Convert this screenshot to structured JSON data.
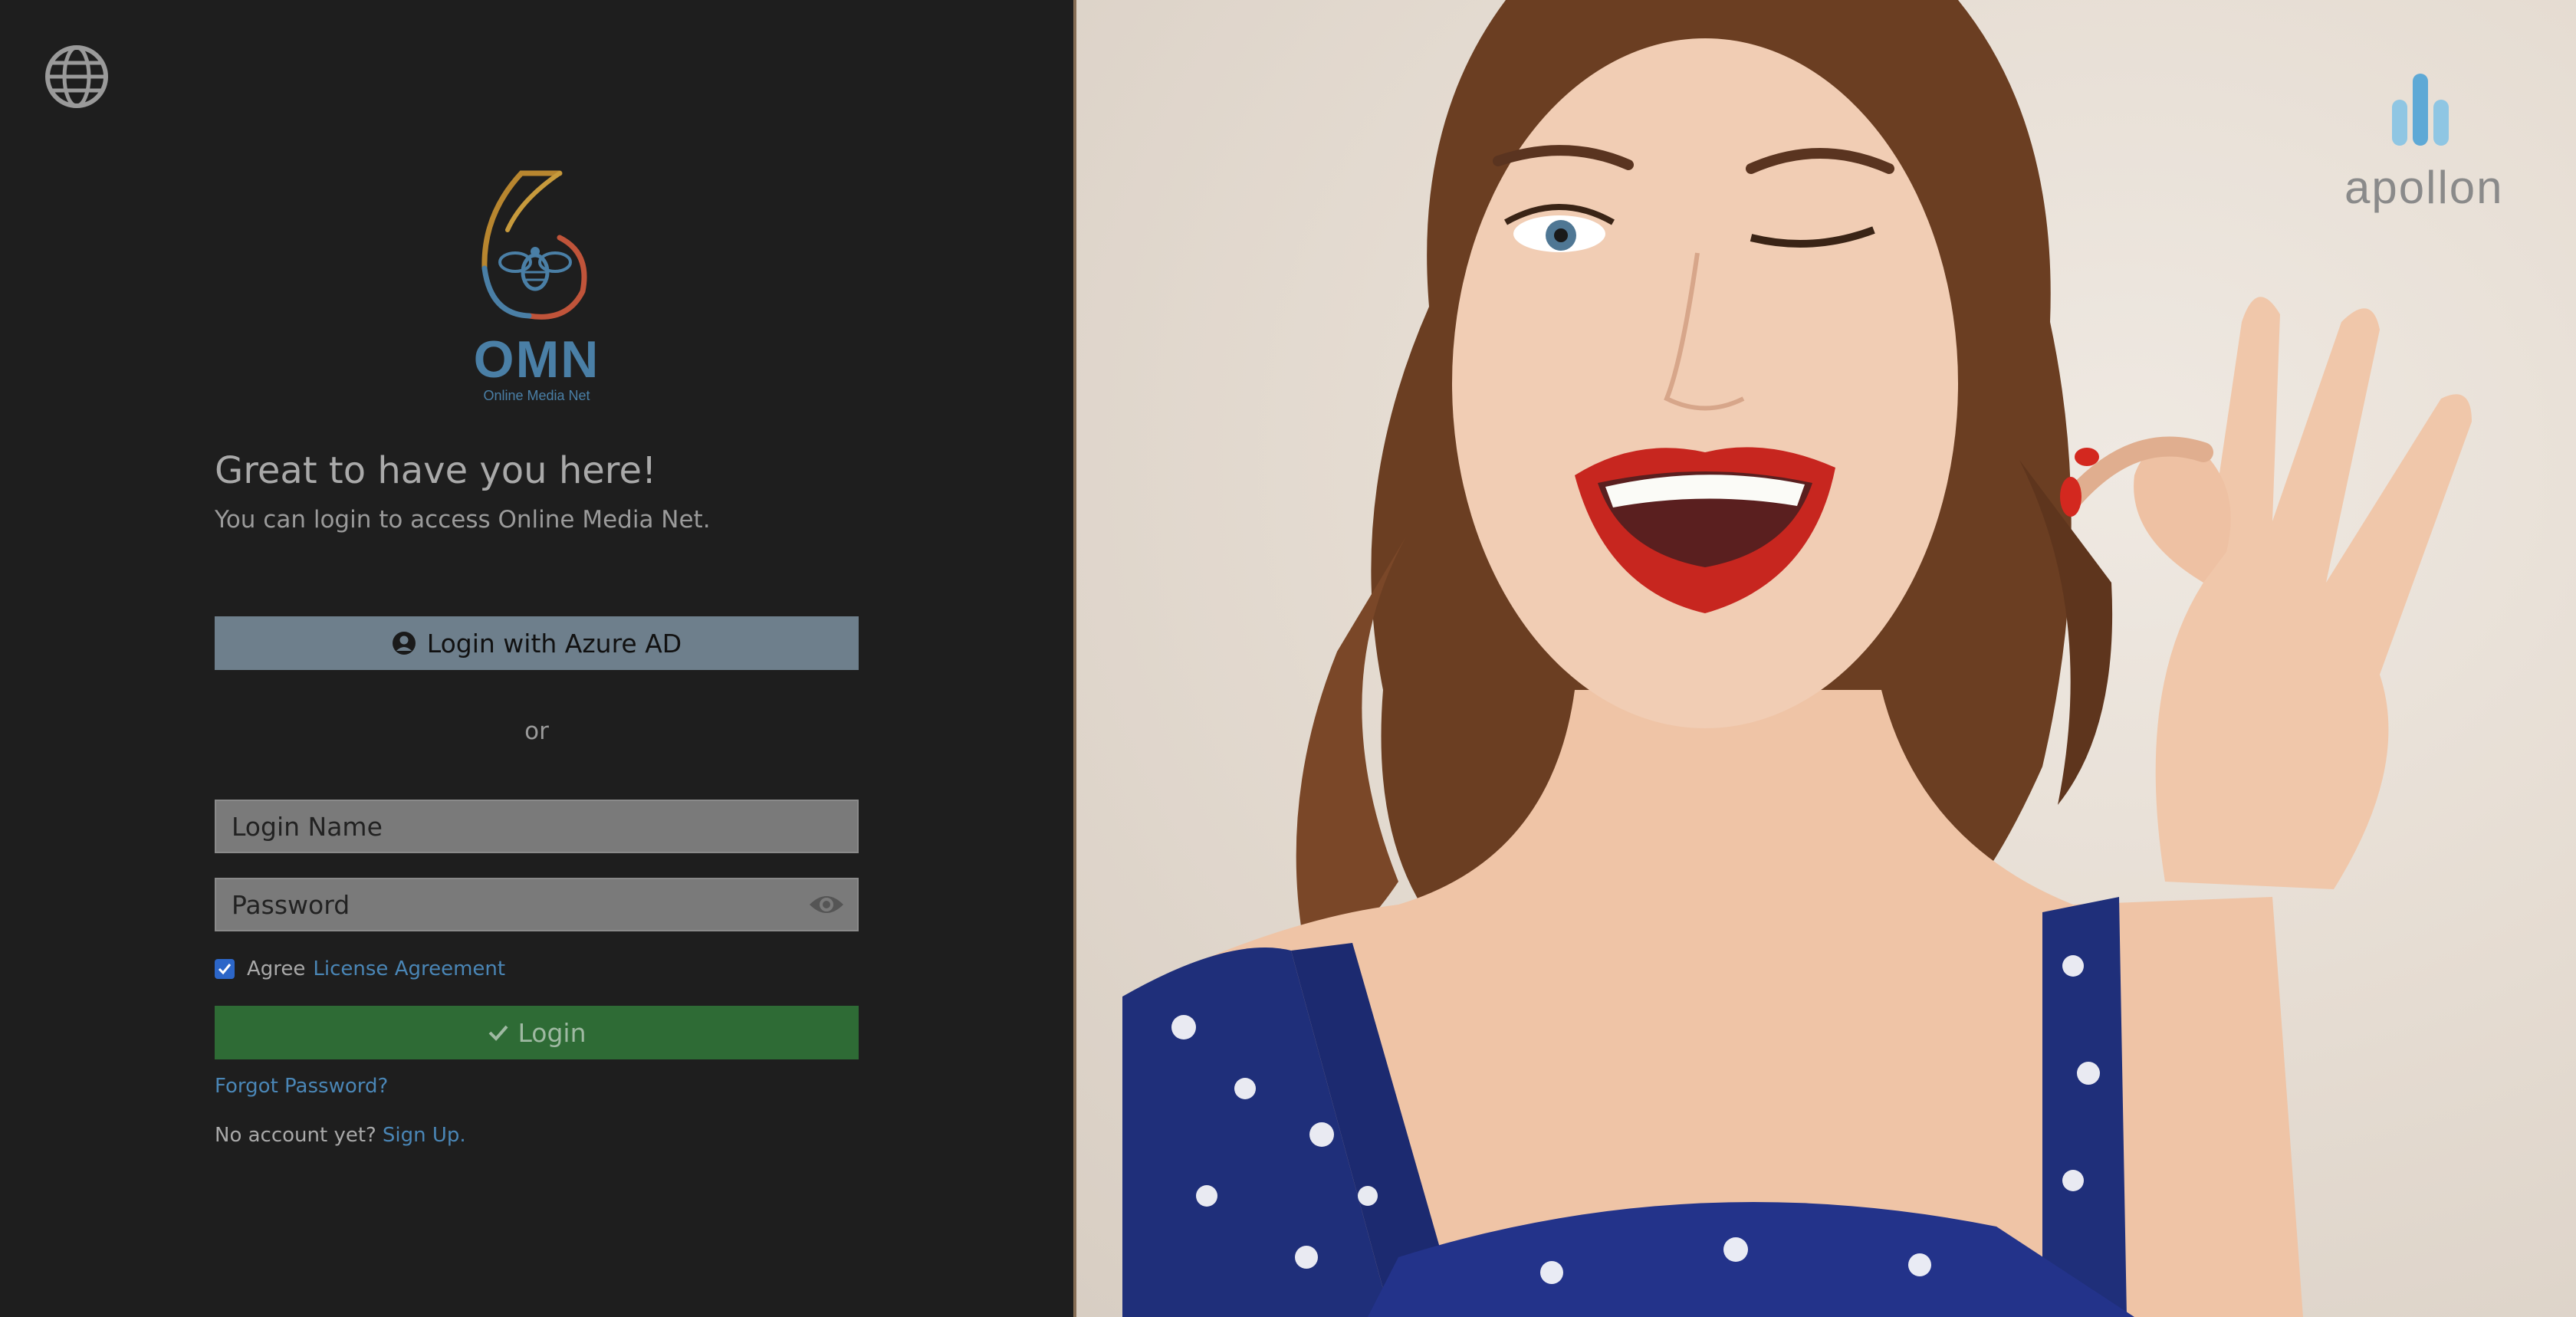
{
  "language": {
    "icon": "globe-icon"
  },
  "brand": {
    "name": "OMN",
    "subtitle": "Online Media Net"
  },
  "welcome": {
    "title": "Great to have you here!",
    "subtitle": "You can login to access Online Media Net."
  },
  "azure": {
    "label": "Login with Azure AD",
    "icon": "user-circle-icon"
  },
  "separator": "or",
  "form": {
    "login_placeholder": "Login Name",
    "login_value": "",
    "password_placeholder": "Password",
    "password_value": "",
    "agree_checked": true,
    "agree_label": "Agree",
    "license_link": "License Agreement",
    "login_label": "Login",
    "forgot_link": "Forgot Password?",
    "no_account": "No account yet?",
    "signup_link": "Sign Up."
  },
  "partner": {
    "name": "apollon"
  },
  "colors": {
    "accent": "#4a86b6",
    "azure_button": "#6e7f8c",
    "login_button": "#2e6b35",
    "panel": "#1e1e1e"
  }
}
